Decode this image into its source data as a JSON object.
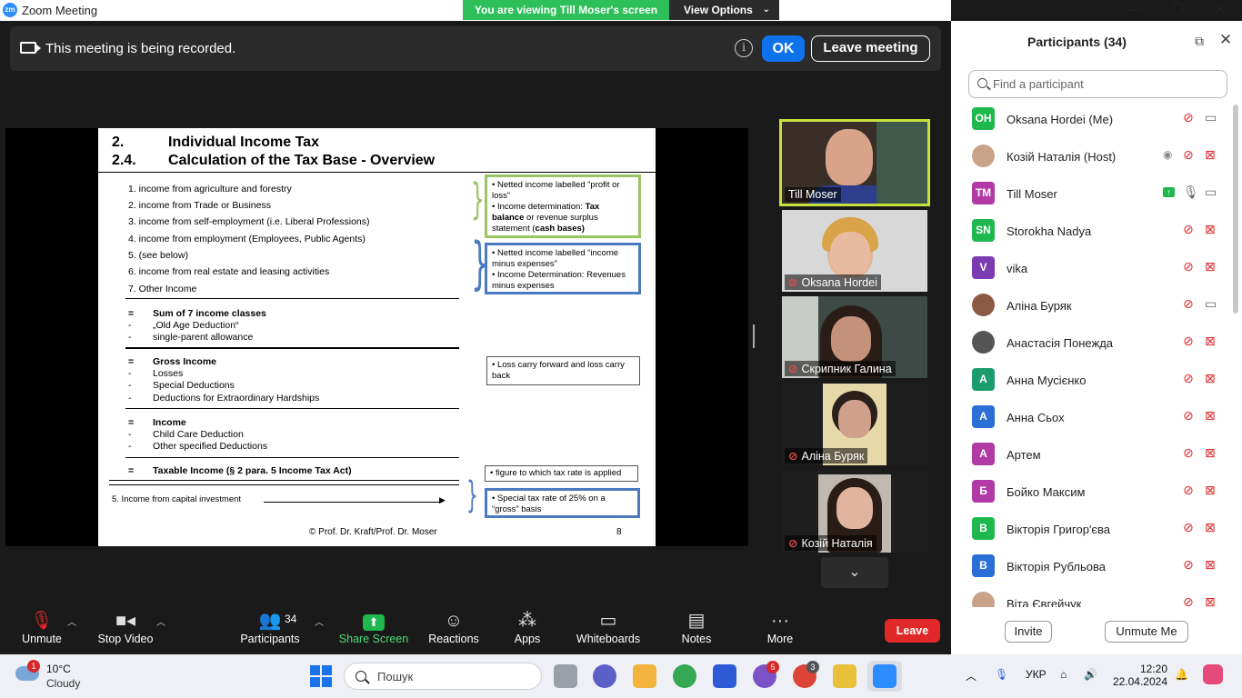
{
  "window": {
    "title": "Zoom Meeting",
    "logo_text": "zm"
  },
  "banner": {
    "viewing": "You are viewing Till Moser's screen",
    "view_options": "View Options"
  },
  "recording": {
    "message": "This meeting is being recorded.",
    "ok": "OK",
    "leave": "Leave meeting"
  },
  "slide": {
    "heading_num1": "2.",
    "heading1": "Individual Income Tax",
    "heading_num2": "2.4.",
    "heading2": "Calculation of the Tax Base - Overview",
    "income_items": [
      "1.  income from agriculture and forestry",
      "2.  income from Trade or Business",
      "3.  income from self-employment (i.e. Liberal Professions)",
      "4.  income from employment (Employees, Public Agents)",
      "5.  (see below)",
      "6.  income from real estate and leasing activities",
      "7.  Other Income"
    ],
    "eq": "=",
    "dash": "-",
    "sum_title": "Sum of 7 income classes",
    "sum_items": [
      "„Old Age Deduction“",
      "single-parent allowance"
    ],
    "gross_title": "Gross Income",
    "gross_items": [
      "Losses",
      "Special Deductions",
      "Deductions for Extraordinary Hardships"
    ],
    "income_title": "Income",
    "income_subitems": [
      "Child Care Deduction",
      "Other specified Deductions"
    ],
    "taxable": "Taxable Income (§ 2 para. 5 Income Tax Act)",
    "capital": "5. Income from capital investment",
    "box_green_1": "• Netted income labelled “profit or loss”",
    "box_green_2a": "• Income determination: ",
    "box_green_2b": "Tax balance",
    "box_green_2c": " or revenue surplus statement  (",
    "box_green_2d": "cash bases)",
    "box_blue_1": "• Netted income labelled “income minus expenses”",
    "box_blue_2": "• Income Determination: Revenues minus expenses",
    "box_loss": "• Loss carry forward and loss carry back",
    "box_rate": "• figure to which tax rate is applied",
    "box_special": "• Special tax rate of 25% on a “gross” basis",
    "footer": "© Prof. Dr. Kraft/Prof. Dr. Moser",
    "page": "8"
  },
  "videos": [
    {
      "name": "Till Moser"
    },
    {
      "name": "Oksana Hordei"
    },
    {
      "name": "Скрипник Галина"
    },
    {
      "name": "Аліна Буряк"
    },
    {
      "name": "Козій Наталія"
    }
  ],
  "participants": {
    "title": "Participants (34)",
    "search_placeholder": "Find a participant",
    "list": [
      {
        "initials": "OH",
        "name": "Oksana Hordei (Me)",
        "color": "#1fb84e"
      },
      {
        "initials": "",
        "name": "Козій Наталія (Host)",
        "color": "#c9a28a"
      },
      {
        "initials": "TM",
        "name": "Till Moser",
        "color": "#b23aa6"
      },
      {
        "initials": "SN",
        "name": "Storokha Nadya",
        "color": "#1fb84e"
      },
      {
        "initials": "V",
        "name": "vika",
        "color": "#7a3ab2"
      },
      {
        "initials": "",
        "name": "Аліна Буряк",
        "color": "#8a5a44"
      },
      {
        "initials": "",
        "name": "Анастасія Понежда",
        "color": "#555555"
      },
      {
        "initials": "А",
        "name": "Анна Мусієнко",
        "color": "#1a9c6e"
      },
      {
        "initials": "А",
        "name": "Анна Сьох",
        "color": "#2b6fd6"
      },
      {
        "initials": "А",
        "name": "Артем",
        "color": "#b23aa6"
      },
      {
        "initials": "Б",
        "name": "Бойко Максим",
        "color": "#b23aa6"
      },
      {
        "initials": "В",
        "name": "Вікторія Григор'єва",
        "color": "#1fb84e"
      },
      {
        "initials": "В",
        "name": "Вікторія Рубльова",
        "color": "#2b6fd6"
      },
      {
        "initials": "",
        "name": "Віта Євгейчук",
        "color": "#c9a28a"
      }
    ],
    "invite": "Invite",
    "unmute_me": "Unmute Me"
  },
  "toolbar": {
    "unmute": "Unmute",
    "stop_video": "Stop Video",
    "participants": "Participants",
    "participants_count": "34",
    "share_screen": "Share Screen",
    "reactions": "Reactions",
    "apps": "Apps",
    "whiteboards": "Whiteboards",
    "notes": "Notes",
    "more": "More",
    "leave": "Leave"
  },
  "taskbar": {
    "weather_badge": "1",
    "temp": "10°C",
    "condition": "Cloudy",
    "search": "Пошук",
    "viber_badge": "5",
    "chrome_badge": "3",
    "lang": "УКР",
    "time": "12:20",
    "date": "22.04.2024"
  }
}
